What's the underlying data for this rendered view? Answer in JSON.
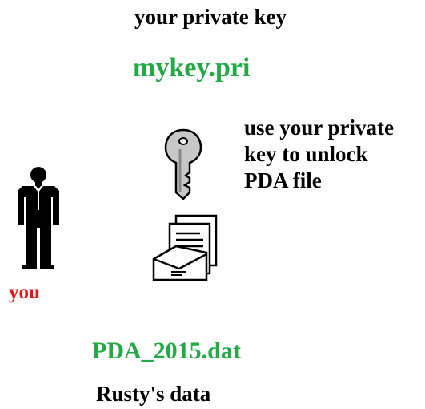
{
  "key_title": "your private key",
  "key_file": "mykey.pri",
  "instruction": {
    "line1": "use your private",
    "line2": "key to unlock",
    "line3": "PDA file"
  },
  "person_label": "you",
  "pda_file": "PDA_2015.dat",
  "data_owner": "Rusty's data",
  "icons": {
    "key": "key-icon",
    "documents": "envelope-documents-icon",
    "person": "person-icon"
  },
  "colors": {
    "filename": "#22aa44",
    "person_label": "#ee1111",
    "text": "#000000"
  }
}
